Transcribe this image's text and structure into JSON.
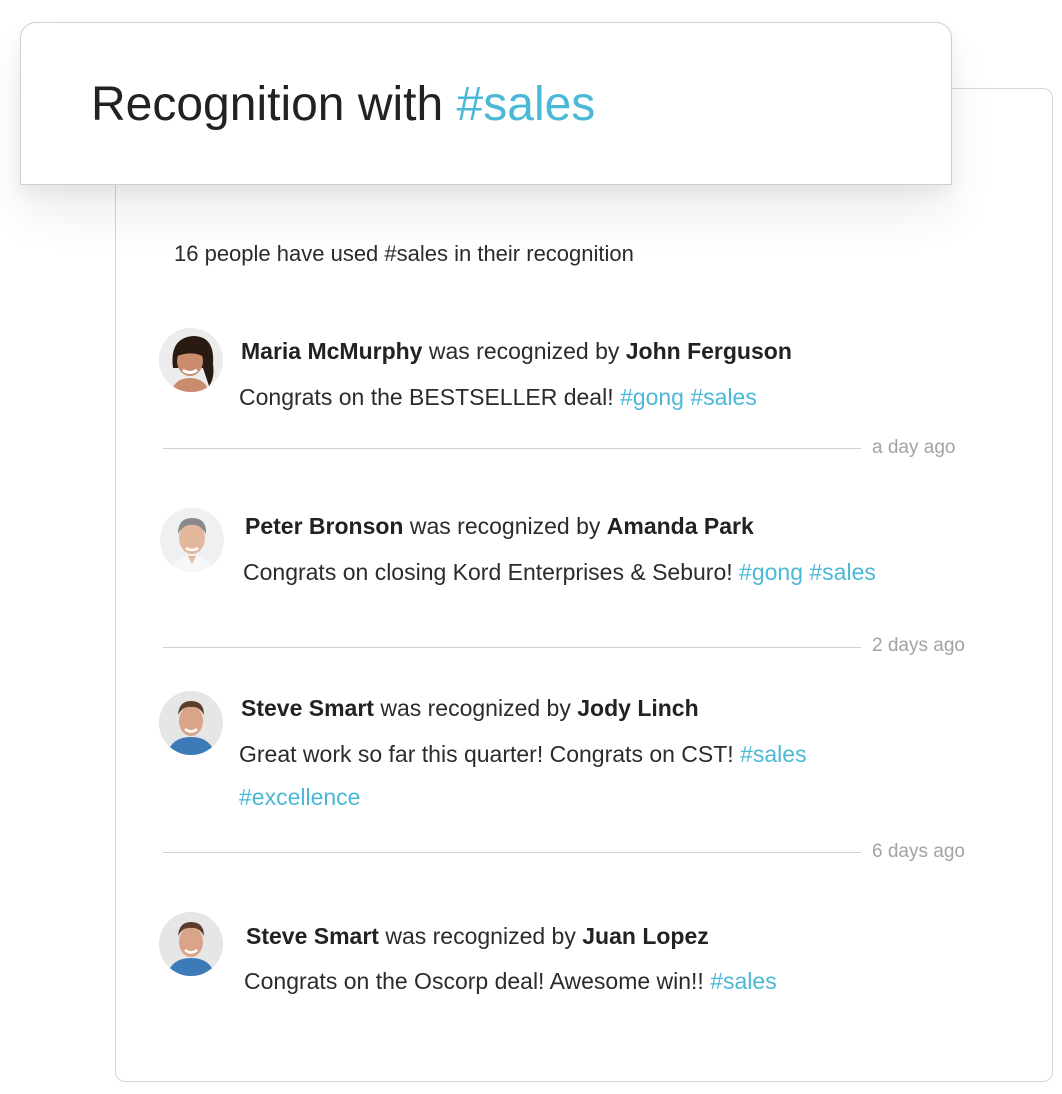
{
  "header": {
    "title_prefix": "Recognition with",
    "title_hashtag": "#sales"
  },
  "summary": "16 people have used #sales in their recognition",
  "connector": "was recognized by",
  "entries": [
    {
      "recipient": "Maria McMurphy",
      "giver": "John Ferguson",
      "message": "Congrats on the BESTSELLER deal!",
      "tags": "#gong #sales",
      "time": "a day ago",
      "avatar_icon": "person-avatar"
    },
    {
      "recipient": "Peter Bronson",
      "giver": "Amanda Park",
      "message": "Congrats on closing Kord Enterprises & Seburo!",
      "tags": "#gong #sales",
      "time": "2 days ago",
      "avatar_icon": "person-avatar"
    },
    {
      "recipient": "Steve Smart",
      "giver": "Jody Linch",
      "message": "Great work so far this quarter! Congrats on CST!",
      "tags": "#sales #excellence",
      "time": "6 days ago",
      "avatar_icon": "person-avatar"
    },
    {
      "recipient": "Steve Smart",
      "giver": "Juan Lopez",
      "message": "Congrats on the Oscorp deal! Awesome win!!",
      "tags": "#sales",
      "avatar_icon": "person-avatar"
    }
  ],
  "colors": {
    "hashtag": "#4ab8d6",
    "timestamp": "#a3a3a3",
    "divider": "#cfcfcf"
  }
}
